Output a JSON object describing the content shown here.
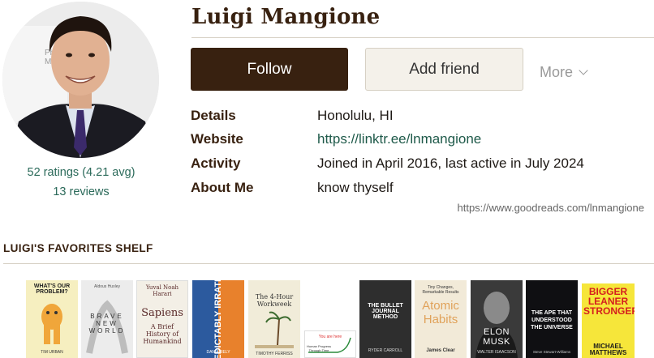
{
  "profile": {
    "name": "Luigi Mangione",
    "photo_text": "Philad\nMuse",
    "ratings": "52 ratings (4.21 avg)",
    "reviews": "13 reviews"
  },
  "actions": {
    "follow": "Follow",
    "add_friend": "Add friend",
    "more": "More"
  },
  "info": [
    {
      "label": "Details",
      "value": "Honolulu, HI"
    },
    {
      "label": "Website",
      "value": "https://linktr.ee/lnmangione"
    },
    {
      "label": "Activity",
      "value": "Joined in April 2016, last active in July 2024"
    },
    {
      "label": "About Me",
      "value": "know thyself"
    }
  ],
  "profile_url": "https://www.goodreads.com/lnmangione",
  "shelf": {
    "title": "LUIGI'S FAVORITES SHELF",
    "books": [
      {
        "title": "WHAT'S OUR PROBLEM?",
        "subtitle": "",
        "author": "TIM URBAN"
      },
      {
        "title": "BRAVE NEW WORLD",
        "subtitle": "",
        "author": "Aldous Huxley"
      },
      {
        "title": "Sapiens",
        "subtitle": "A Brief History of Humankind",
        "author": "Yuval Noah Harari"
      },
      {
        "title": "PREDICTABLY IRRATIONAL",
        "subtitle": "",
        "author": "DAN ARIELY"
      },
      {
        "title": "The 4-Hour Workweek",
        "subtitle": "",
        "author": "TIMOTHY FERRISS"
      },
      {
        "title": "You are here",
        "subtitle": "Human Progress Through Time",
        "author": ""
      },
      {
        "title": "THE BULLET JOURNAL METHOD",
        "subtitle": "",
        "author": "RYDER CARROLL"
      },
      {
        "title": "Atomic Habits",
        "subtitle": "Tiny Changes, Remarkable Results",
        "author": "James Clear"
      },
      {
        "title": "ELON MUSK",
        "subtitle": "",
        "author": "WALTER ISAACSON"
      },
      {
        "title": "THE APE THAT UNDERSTOOD THE UNIVERSE",
        "subtitle": "",
        "author": "Steve Stewart-Williams"
      },
      {
        "title": "BIGGER LEANER STRONGER",
        "subtitle": "",
        "author": "MICHAEL MATTHEWS"
      }
    ]
  }
}
